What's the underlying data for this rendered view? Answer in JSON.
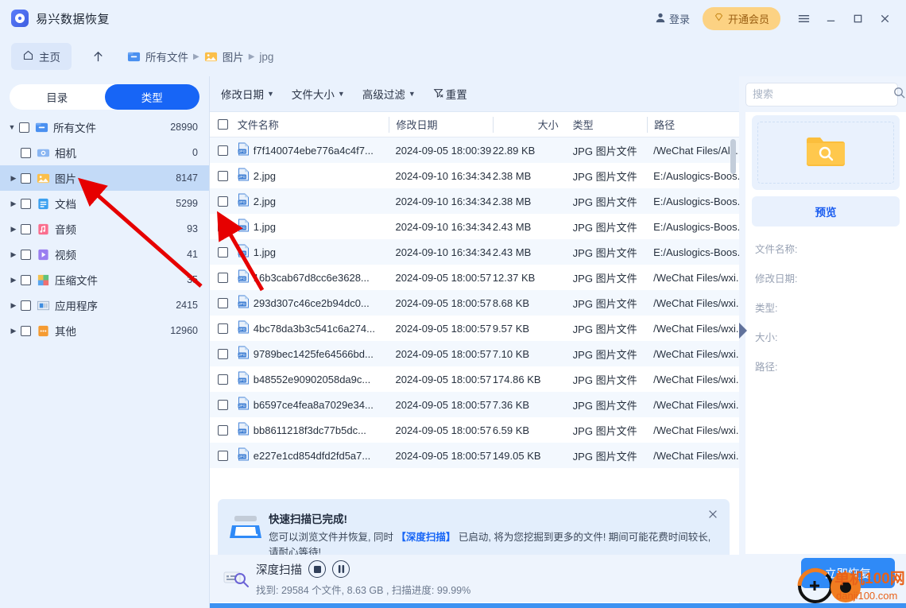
{
  "app": {
    "title": "易兴数据恢复",
    "logo_icon": "app-logo-icon"
  },
  "titlebar": {
    "login_label": "登录",
    "login_icon": "user-icon",
    "vip_label": "开通会员",
    "vip_icon": "diamond-icon",
    "menu_icon": "hamburger-menu-icon",
    "minimize_icon": "minimize-icon",
    "maximize_icon": "maximize-icon",
    "close_icon": "close-icon"
  },
  "nav": {
    "home_label": "主页",
    "home_icon": "home-icon",
    "up_icon": "arrow-up-icon",
    "breadcrumbs": [
      {
        "label": "所有文件",
        "icon": "folder-blue-icon"
      },
      {
        "label": "图片",
        "icon": "image-orange-icon"
      },
      {
        "label": "jpg",
        "icon": ""
      }
    ]
  },
  "sidebar": {
    "tabs": [
      {
        "label": "目录",
        "active": false
      },
      {
        "label": "类型",
        "active": true
      }
    ],
    "tree": [
      {
        "label": "所有文件",
        "count": "28990",
        "icon": "folder-blue-icon",
        "level": 0,
        "expanded": true,
        "has_arrow": true,
        "selected": false
      },
      {
        "label": "相机",
        "count": "0",
        "icon": "camera-icon",
        "level": 1,
        "expanded": false,
        "has_arrow": false,
        "selected": false
      },
      {
        "label": "图片",
        "count": "8147",
        "icon": "image-orange-icon",
        "level": 1,
        "expanded": false,
        "has_arrow": true,
        "selected": true
      },
      {
        "label": "文档",
        "count": "5299",
        "icon": "document-icon",
        "level": 1,
        "expanded": false,
        "has_arrow": true,
        "selected": false
      },
      {
        "label": "音频",
        "count": "93",
        "icon": "audio-icon",
        "level": 1,
        "expanded": false,
        "has_arrow": true,
        "selected": false
      },
      {
        "label": "视频",
        "count": "41",
        "icon": "video-icon",
        "level": 1,
        "expanded": false,
        "has_arrow": true,
        "selected": false
      },
      {
        "label": "压缩文件",
        "count": "35",
        "icon": "archive-icon",
        "level": 1,
        "expanded": false,
        "has_arrow": true,
        "selected": false
      },
      {
        "label": "应用程序",
        "count": "2415",
        "icon": "application-icon",
        "level": 1,
        "expanded": false,
        "has_arrow": true,
        "selected": false
      },
      {
        "label": "其他",
        "count": "12960",
        "icon": "other-icon",
        "level": 1,
        "expanded": false,
        "has_arrow": true,
        "selected": false
      }
    ]
  },
  "filterbar": {
    "items": [
      {
        "label": "修改日期",
        "dropdown": true
      },
      {
        "label": "文件大小",
        "dropdown": true
      },
      {
        "label": "高级过滤",
        "dropdown": true
      }
    ],
    "reset_label": "重置",
    "reset_icon": "filter-clear-icon"
  },
  "search": {
    "placeholder": "搜索",
    "value": "",
    "icon": "search-icon"
  },
  "table": {
    "columns": [
      "文件名称",
      "修改日期",
      "大小",
      "类型",
      "路径"
    ],
    "rows": [
      {
        "name": "f7f140074ebe776a4c4f7...",
        "date": "2024-09-05 18:00:39",
        "size": "22.89 KB",
        "type": "JPG 图片文件",
        "path": "/WeChat Files/All ..."
      },
      {
        "name": "2.jpg",
        "date": "2024-09-10 16:34:34",
        "size": "2.38 MB",
        "type": "JPG 图片文件",
        "path": "E:/Auslogics-Boos..."
      },
      {
        "name": "2.jpg",
        "date": "2024-09-10 16:34:34",
        "size": "2.38 MB",
        "type": "JPG 图片文件",
        "path": "E:/Auslogics-Boos..."
      },
      {
        "name": "1.jpg",
        "date": "2024-09-10 16:34:34",
        "size": "2.43 MB",
        "type": "JPG 图片文件",
        "path": "E:/Auslogics-Boos..."
      },
      {
        "name": "1.jpg",
        "date": "2024-09-10 16:34:34",
        "size": "2.43 MB",
        "type": "JPG 图片文件",
        "path": "E:/Auslogics-Boos..."
      },
      {
        "name": "16b3cab67d8cc6e3628...",
        "date": "2024-09-05 18:00:57",
        "size": "12.37 KB",
        "type": "JPG 图片文件",
        "path": "/WeChat Files/wxi..."
      },
      {
        "name": "293d307c46ce2b94dc0...",
        "date": "2024-09-05 18:00:57",
        "size": "8.68 KB",
        "type": "JPG 图片文件",
        "path": "/WeChat Files/wxi..."
      },
      {
        "name": "4bc78da3b3c541c6a274...",
        "date": "2024-09-05 18:00:57",
        "size": "9.57 KB",
        "type": "JPG 图片文件",
        "path": "/WeChat Files/wxi..."
      },
      {
        "name": "9789bec1425fe64566bd...",
        "date": "2024-09-05 18:00:57",
        "size": "7.10 KB",
        "type": "JPG 图片文件",
        "path": "/WeChat Files/wxi..."
      },
      {
        "name": "b48552e90902058da9c...",
        "date": "2024-09-05 18:00:57",
        "size": "174.86 KB",
        "type": "JPG 图片文件",
        "path": "/WeChat Files/wxi..."
      },
      {
        "name": "b6597ce4fea8a7029e34...",
        "date": "2024-09-05 18:00:57",
        "size": "7.36 KB",
        "type": "JPG 图片文件",
        "path": "/WeChat Files/wxi..."
      },
      {
        "name": "bb8611218f3dc77b5dc...",
        "date": "2024-09-05 18:00:57",
        "size": "6.59 KB",
        "type": "JPG 图片文件",
        "path": "/WeChat Files/wxi..."
      },
      {
        "name": "e227e1cd854dfd2fd5a7...",
        "date": "2024-09-05 18:00:57",
        "size": "149.05 KB",
        "type": "JPG 图片文件",
        "path": "/WeChat Files/wxi..."
      }
    ]
  },
  "banner": {
    "icon": "scanner-icon",
    "title": "快速扫描已完成!",
    "body_part1": "您可以浏览文件并恢复, 同时 ",
    "link": "【深度扫描】",
    "body_part2": " 已启动, 将为您挖掘到更多的文件! 期间可能花费时间较长, 请耐心等待!",
    "close_icon": "close-icon"
  },
  "status": {
    "icon": "scan-search-icon",
    "title": "深度扫描",
    "stop_icon": "stop-icon",
    "pause_icon": "pause-icon",
    "detail": "找到: 29584 个文件, 8.63 GB , 扫描进度: 99.99%",
    "progress_percent": 99.99,
    "recover_label": "立即恢复"
  },
  "preview": {
    "placeholder_icon": "folder-search-icon",
    "preview_label": "预览",
    "fields": [
      {
        "label": "文件名称:",
        "value": ""
      },
      {
        "label": "修改日期:",
        "value": ""
      },
      {
        "label": "类型:",
        "value": ""
      },
      {
        "label": "大小:",
        "value": ""
      },
      {
        "label": "路径:",
        "value": ""
      }
    ],
    "collapse_icon": "collapse-right-icon"
  },
  "watermark": {
    "text_cn": "单机100网",
    "text_en": "danji100.com"
  },
  "colors": {
    "accent": "#1765f6",
    "vip": "#fcd283",
    "header_bg": "#eaf2fd",
    "selected_row": "#c3daf7",
    "recover_btn": "#2f8af7",
    "annotation_arrow": "#e60000"
  }
}
